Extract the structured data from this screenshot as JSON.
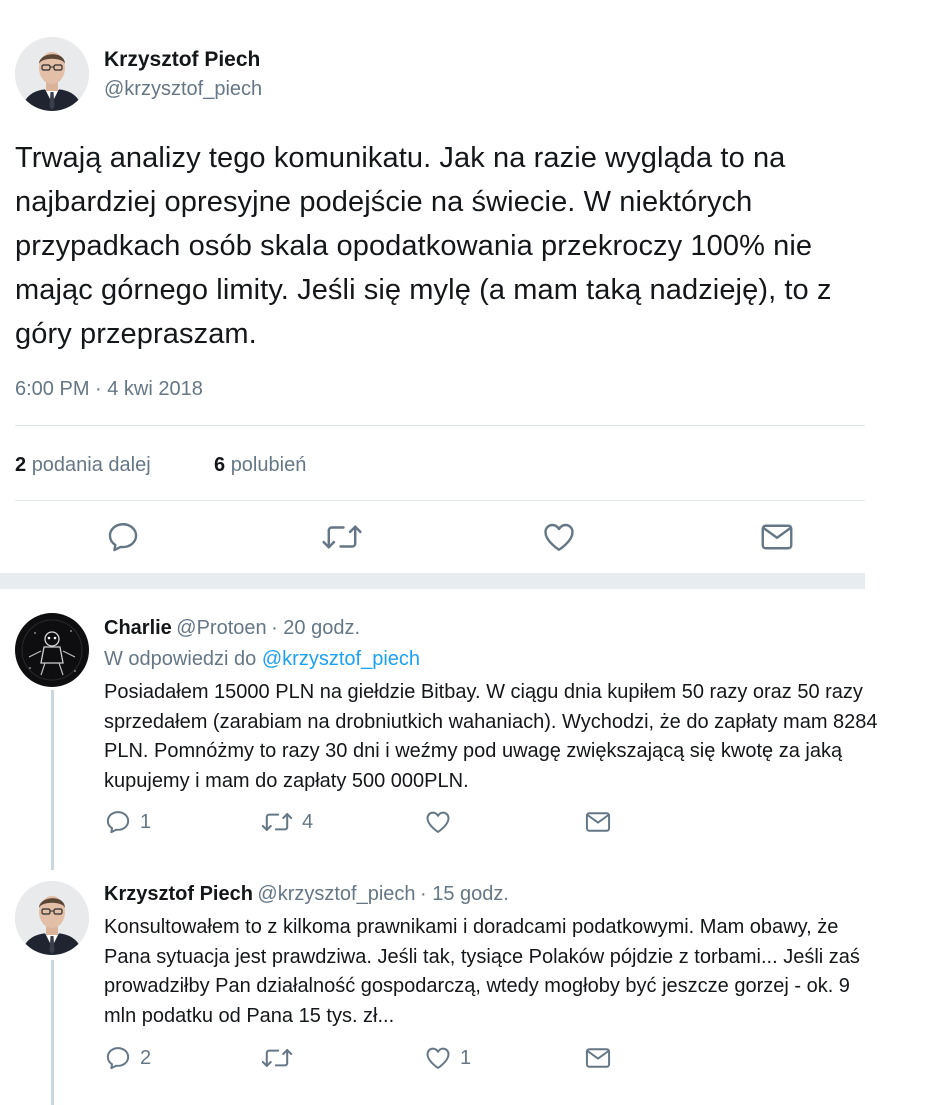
{
  "main_tweet": {
    "name": "Krzysztof Piech",
    "handle": "@krzysztof_piech",
    "text": "Trwają analizy tego komunikatu. Jak na razie wygląda to na najbardziej opresyjne podejście na świecie. W niektórych przypadkach osób skala opodatkowania przekroczy 100% nie mając górnego limity. Jeśli się mylę (a mam taką nadzieję), to z góry przepraszam.",
    "timestamp": "6:00 PM · 4 kwi 2018",
    "retweets_count": "2",
    "retweets_label": "podania dalej",
    "likes_count": "6",
    "likes_label": "polubień"
  },
  "replies": [
    {
      "name": "Charlie",
      "handle": "@Protoen",
      "time": "· 20 godz.",
      "in_reply_prefix": "W odpowiedzi do",
      "in_reply_handle": "@krzysztof_piech",
      "text": "Posiadałem 15000 PLN na giełdzie Bitbay. W ciągu dnia kupiłem 50 razy oraz 50 razy sprzedałem (zarabiam na drobniutkich wahaniach). Wychodzi, że do zapłaty mam 8284 PLN. Pomnóżmy to razy 30 dni i weźmy pod uwagę zwiększającą się kwotę za jaką kupujemy i mam do zapłaty 500 000PLN.",
      "reply_count": "1",
      "retweet_count": "4",
      "like_count": ""
    },
    {
      "name": "Krzysztof Piech",
      "handle": "@krzysztof_piech",
      "time": "· 15 godz.",
      "text": "Konsultowałem to z kilkoma prawnikami i doradcami podatkowymi. Mam obawy, że Pana sytuacja jest prawdziwa. Jeśli tak, tysiące Polaków pójdzie z torbami... Jeśli zaś prowadziłby Pan działalność gospodarczą, wtedy mogłoby być jeszcze gorzej - ok. 9 mln podatku od Pana 15 tys. zł...",
      "reply_count": "2",
      "retweet_count": "",
      "like_count": "1"
    }
  ],
  "icons": {
    "reply": "reply-icon",
    "retweet": "retweet-icon",
    "like": "heart-icon",
    "dm": "envelope-icon"
  },
  "colors": {
    "text": "#14171a",
    "secondary": "#657786",
    "link": "#1da1f2",
    "divider": "#e1e8ed",
    "band": "#e6ecf0"
  }
}
